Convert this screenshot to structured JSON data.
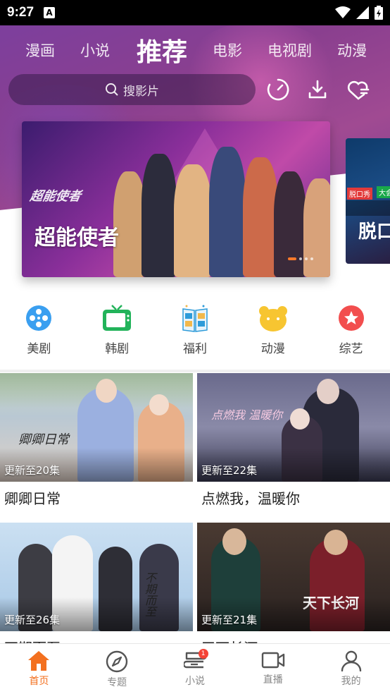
{
  "status_bar": {
    "time": "9:27",
    "notification_icon": "A"
  },
  "category_tabs": [
    {
      "label": "漫画",
      "active": false
    },
    {
      "label": "小说",
      "active": false
    },
    {
      "label": "推荐",
      "active": true
    },
    {
      "label": "电影",
      "active": false
    },
    {
      "label": "电视剧",
      "active": false
    },
    {
      "label": "动漫",
      "active": false
    }
  ],
  "search": {
    "placeholder": "搜影片"
  },
  "top_actions": [
    "history-clock-icon",
    "download-icon",
    "favorite-heart-icon"
  ],
  "banner": {
    "main_title": "超能使者",
    "main_logo_text": "超能使者",
    "side_title": "脱口",
    "side_badge_left": "脱口秀",
    "side_badge_right": "大会",
    "dots_count": 4,
    "active_dot": 0
  },
  "quick_categories": [
    {
      "label": "美剧",
      "icon": "film-reel-icon",
      "color": "#3a9ff0"
    },
    {
      "label": "韩剧",
      "icon": "tv-icon",
      "color": "#22b35a"
    },
    {
      "label": "福利",
      "icon": "book-icon",
      "color": "#2d9bd9"
    },
    {
      "label": "动漫",
      "icon": "bear-icon",
      "color": "#f7c531"
    },
    {
      "label": "综艺",
      "icon": "star-icon",
      "color": "#f24e4e"
    }
  ],
  "cards": [
    {
      "title": "卿卿日常",
      "update": "更新至20集",
      "poster_text": "卿卿日常"
    },
    {
      "title": "点燃我，温暖你",
      "update": "更新至22集",
      "poster_text": "点燃我 温暖你"
    },
    {
      "title": "不期而至",
      "update": "更新至26集",
      "poster_text": "不期而至"
    },
    {
      "title": "天下长河",
      "update": "更新至21集",
      "poster_text": "天下长河"
    }
  ],
  "bottom_nav": [
    {
      "label": "首页",
      "icon": "home-icon",
      "active": true
    },
    {
      "label": "专题",
      "icon": "compass-icon",
      "active": false
    },
    {
      "label": "小说",
      "icon": "novel-icon",
      "active": false,
      "badge": "1"
    },
    {
      "label": "直播",
      "icon": "video-camera-icon",
      "active": false
    },
    {
      "label": "我的",
      "icon": "profile-icon",
      "active": false
    }
  ],
  "colors": {
    "accent": "#f3701f",
    "hero_purple": "#8a3f8f"
  }
}
